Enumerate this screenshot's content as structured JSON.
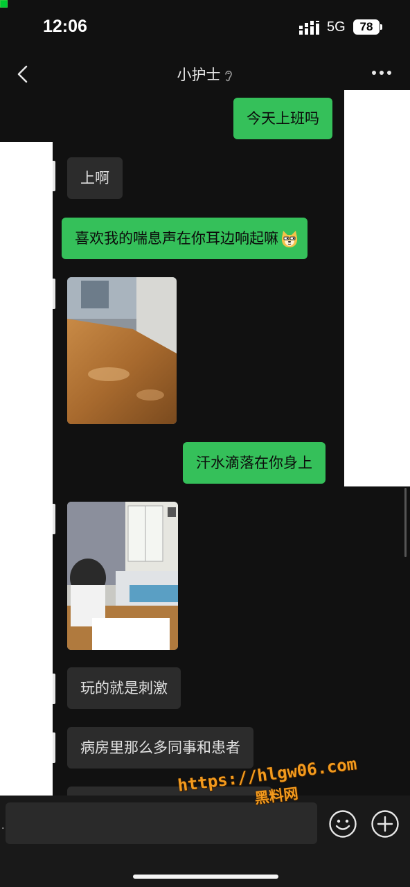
{
  "status_bar": {
    "time": "12:06",
    "network": "5G",
    "battery": "78"
  },
  "header": {
    "title": "小护士",
    "back_icon": "chevron-left-icon",
    "ear_icon": "ear-icon",
    "more_icon": "more-horizontal-icon"
  },
  "messages": [
    {
      "direction": "out",
      "text": "今天上班吗"
    },
    {
      "direction": "in",
      "text": "上啊"
    },
    {
      "direction": "out",
      "text": "喜欢我的喘息声在你耳边响起嘛",
      "emoji": "dog-face-emoji"
    },
    {
      "direction": "in",
      "type": "image",
      "description": "wooden-table-photo"
    },
    {
      "direction": "out",
      "text": "汗水滴落在你身上"
    },
    {
      "direction": "in",
      "type": "image",
      "description": "ward-room-photo"
    },
    {
      "direction": "in",
      "text": "玩的就是刺激"
    },
    {
      "direction": "in",
      "text": "病房里那么多同事和患者"
    }
  ],
  "input_bar": {
    "emoji_icon": "smiley-icon",
    "plus_icon": "plus-circle-icon"
  },
  "watermark": {
    "url": "https://hlgw06.com",
    "site_name": "黑料网"
  },
  "colors": {
    "background": "#111111",
    "outgoing_bubble": "#35c05a",
    "incoming_bubble": "#2c2c2c",
    "watermark": "#f39a1d"
  }
}
